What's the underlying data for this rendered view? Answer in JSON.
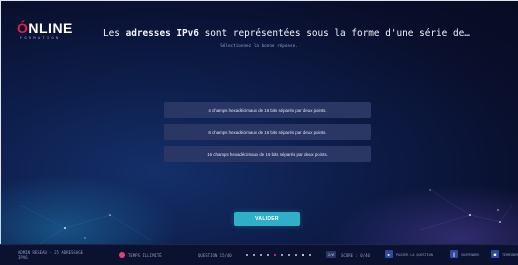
{
  "logo": {
    "brand_prefix": "Ó",
    "brand_rest": "NLINE",
    "subtitle": "FORMATION"
  },
  "question": {
    "before": "Les ",
    "bold": "adresses IPv6",
    "after": " sont représentées sous la forme d'une série de…",
    "instruction": "Sélectionnez la bonne réponse."
  },
  "answers": [
    "4 champs hexadécimaux de 16 bits séparés par deux points.",
    "8 champs hexadécimaux de 16 bits séparés par deux points.",
    "16 champs hexadécimaux de 16 bits séparés par deux points."
  ],
  "validate_label": "VALIDER",
  "footer": {
    "breadcrumb_line1": "ADMIN RESEAU - 25 ADRESSAGE",
    "breadcrumb_line2": "IPV6",
    "timer": "TEMPS ILLIMITÉ",
    "question_progress": "QUESTION 15/40",
    "counter": "2/6",
    "score": "SCORE : 0/40",
    "pass_label": "PASSER LA QUESTION",
    "suspend_label": "SUSPENDRE",
    "terminate_label": "TERMINER",
    "colors": {
      "accent": "#2fb0c6",
      "timer_dot": "#e0407a",
      "button": "#2d4aa0"
    }
  }
}
